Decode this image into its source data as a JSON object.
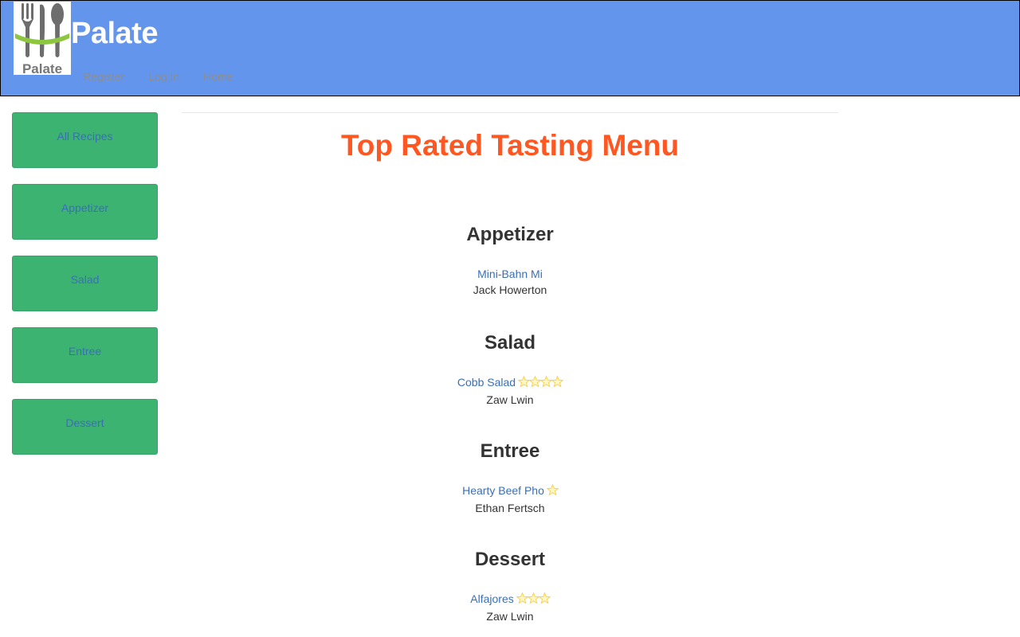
{
  "header": {
    "brand": "Palate",
    "logo_text": "Palate",
    "nav": [
      {
        "label": "Register"
      },
      {
        "label": "Log In"
      },
      {
        "label": "Home"
      }
    ]
  },
  "sidebar": {
    "items": [
      {
        "label": "All Recipes"
      },
      {
        "label": "Appetizer"
      },
      {
        "label": "Salad"
      },
      {
        "label": "Entree"
      },
      {
        "label": "Dessert"
      }
    ]
  },
  "main": {
    "title": "Top Rated Tasting Menu",
    "courses": [
      {
        "heading": "Appetizer",
        "recipe": "Mini-Bahn Mi",
        "author": "Jack Howerton",
        "stars": 0
      },
      {
        "heading": "Salad",
        "recipe": "Cobb Salad",
        "author": "Zaw Lwin",
        "stars": 4
      },
      {
        "heading": "Entree",
        "recipe": "Hearty Beef Pho",
        "author": "Ethan Fertsch",
        "stars": 1
      },
      {
        "heading": "Dessert",
        "recipe": "Alfajores",
        "author": "Zaw Lwin",
        "stars": 3
      }
    ]
  },
  "colors": {
    "header_bg": "#6495ed",
    "sidebar_button_bg": "#3cb371",
    "title": "#ff5722",
    "link": "#3a6fb8",
    "star": "#f7d34a"
  },
  "icons": {
    "logo": "fork-spoon-knife-icon",
    "rating": "star-icon"
  }
}
